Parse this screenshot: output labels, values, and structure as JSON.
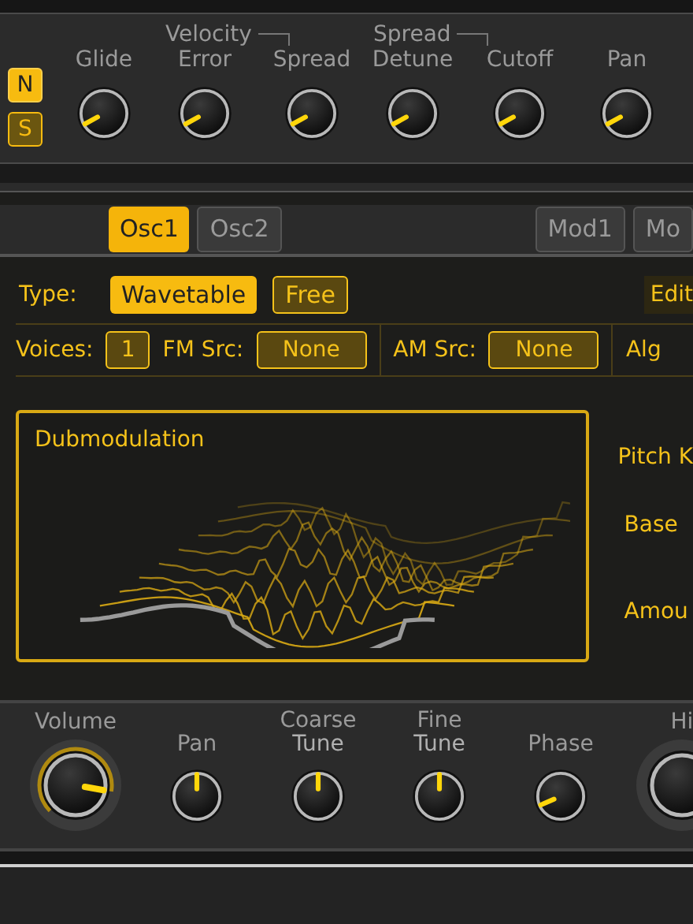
{
  "mode_buttons": [
    {
      "label": "N",
      "selected": true
    },
    {
      "label": "S",
      "selected": false
    }
  ],
  "top_groups": [
    {
      "knobs": [
        {
          "label": "Glide"
        }
      ]
    },
    {
      "title": "Velocity",
      "knobs": [
        {
          "label": "Error"
        },
        {
          "label": "Spread"
        }
      ]
    },
    {
      "title": "Spread",
      "knobs": [
        {
          "label": "Detune"
        },
        {
          "label": "Cutoff"
        },
        {
          "label": "Pan"
        }
      ]
    }
  ],
  "tabs": [
    {
      "label": "Osc1",
      "selected": true
    },
    {
      "label": "Osc2",
      "selected": false
    },
    {
      "label": "Mod1",
      "selected": false
    },
    {
      "label": "Mo",
      "selected": false
    }
  ],
  "type_row": {
    "label": "Type:",
    "options": [
      {
        "label": "Wavetable",
        "selected": true
      },
      {
        "label": "Free",
        "selected": false
      }
    ],
    "edit": "Edit"
  },
  "source_row": [
    {
      "label": "Voices:",
      "value": "1"
    },
    {
      "label": "FM Src:",
      "value": "None"
    },
    {
      "label": "AM Src:",
      "value": "None"
    },
    {
      "label": "Alg"
    }
  ],
  "display": {
    "title": "Dubmodulation"
  },
  "side_labels": [
    "Pitch K",
    "Base",
    "Amou"
  ],
  "bottom_knobs": [
    {
      "label": "Volume",
      "kind": "halo"
    },
    {
      "label": "Pan",
      "kind": "plain"
    },
    {
      "label": "Coarse",
      "sublabel": "Tune",
      "kind": "plain"
    },
    {
      "label": "Fine",
      "sublabel": "Tune",
      "kind": "plain"
    },
    {
      "label": "Phase",
      "kind": "plain"
    },
    {
      "label": "Hi",
      "kind": "halo"
    }
  ]
}
